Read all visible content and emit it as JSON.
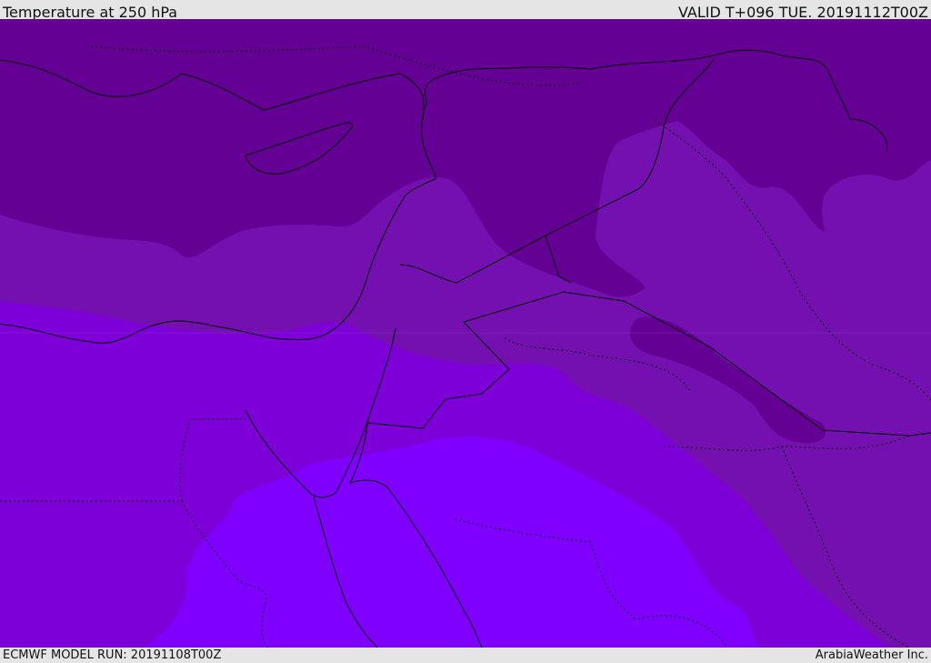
{
  "header": {
    "title": "Temperature at 250 hPa",
    "valid": "VALID T+096 TUE. 20191112T00Z"
  },
  "footer": {
    "model_run": "ECMWF MODEL RUN: 20191108T00Z",
    "credit": "ArabiaWeather Inc."
  },
  "colors": {
    "band1": "#650094",
    "band2": "#7510b0",
    "band3": "#7e00d8",
    "band4": "#7f00ff",
    "coast": "#000000"
  }
}
